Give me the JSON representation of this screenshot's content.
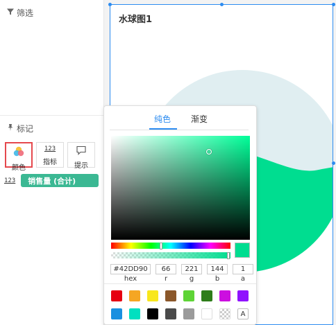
{
  "filter": {
    "label": "筛选",
    "icon": "filter-icon"
  },
  "marks": {
    "label": "标记",
    "icon": "pin-icon",
    "buttons": [
      {
        "label": "颜色",
        "icon": "color-palette-icon",
        "active": true
      },
      {
        "label": "指标",
        "icon": "number-123-icon",
        "glyph": "123"
      },
      {
        "label": "提示",
        "icon": "tooltip-icon"
      }
    ]
  },
  "field": {
    "type_glyph": "123",
    "label": "销售量 (合计)"
  },
  "chart": {
    "title": "水球图1",
    "type": "liquid-fill",
    "fill_color": "#00DD90",
    "background_color": "#E0EEF1"
  },
  "picker": {
    "tabs": [
      "纯色",
      "渐变"
    ],
    "active_tab": "纯色",
    "hex": "#42DD90",
    "r": "66",
    "g": "221",
    "b": "144",
    "a": "1",
    "captions": {
      "hex": "hex",
      "r": "r",
      "g": "g",
      "b": "b",
      "a": "a"
    },
    "hue_color": "#00FF99",
    "preview_color": "#00DD90",
    "swatches": [
      "#E60012",
      "#F5A623",
      "#F8E71C",
      "#8B572A",
      "#5ED436",
      "#2E7D1A",
      "#CC0FE0",
      "#9013FE",
      "#1A90E0",
      "#00E0C0",
      "#000000",
      "#4A4A4A",
      "#9B9B9B",
      "#FFFFFF",
      "transparent",
      "A"
    ]
  }
}
